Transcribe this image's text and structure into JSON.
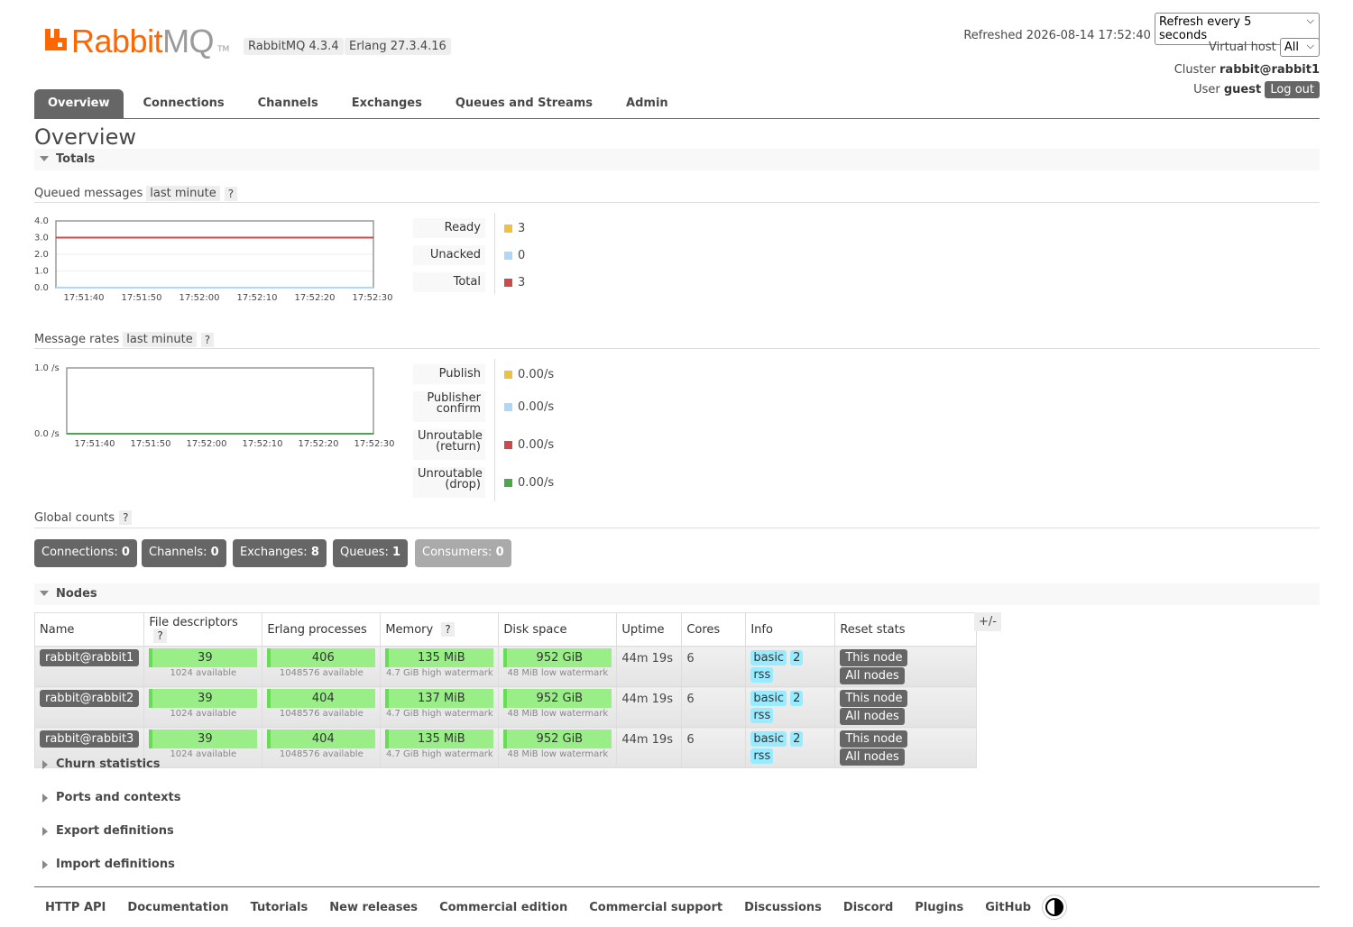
{
  "header": {
    "logo_rabbit": "Rabbit",
    "logo_mq": "MQ",
    "logo_tm": "TM",
    "rabbitmq_version": "RabbitMQ 4.3.4",
    "erlang_version": "Erlang 27.3.4.16",
    "refreshed": "Refreshed 2026-08-14 17:52:40",
    "refresh_select": "Refresh every 5 seconds",
    "vhost_label": "Virtual host",
    "vhost_value": "All",
    "cluster_label": "Cluster",
    "cluster_value": "rabbit@rabbit1",
    "user_label": "User",
    "user_value": "guest",
    "logout": "Log out"
  },
  "tabs": [
    "Overview",
    "Connections",
    "Channels",
    "Exchanges",
    "Queues and Streams",
    "Admin"
  ],
  "page_title": "Overview",
  "totals": {
    "section": "Totals",
    "queued_label": "Queued messages",
    "queued_range": "last minute",
    "rates_label": "Message rates",
    "rates_range": "last minute",
    "help": "?",
    "queued_legend": [
      {
        "label": "Ready",
        "value": "3",
        "color": "#edc240"
      },
      {
        "label": "Unacked",
        "value": "0",
        "color": "#afd8f8"
      },
      {
        "label": "Total",
        "value": "3",
        "color": "#cb4b4b"
      }
    ],
    "rates_legend": [
      {
        "label1": "Publish",
        "label2": "",
        "value": "0.00/s",
        "color": "#edc240"
      },
      {
        "label1": "Publisher",
        "label2": "confirm",
        "value": "0.00/s",
        "color": "#afd8f8"
      },
      {
        "label1": "Unroutable",
        "label2": "(return)",
        "value": "0.00/s",
        "color": "#cb4b4b"
      },
      {
        "label1": "Unroutable",
        "label2": "(drop)",
        "value": "0.00/s",
        "color": "#4da74d"
      }
    ],
    "global_label": "Global counts",
    "global_counts": [
      {
        "label": "Connections:",
        "value": "0"
      },
      {
        "label": "Channels:",
        "value": "0"
      },
      {
        "label": "Exchanges:",
        "value": "8"
      },
      {
        "label": "Queues:",
        "value": "1"
      },
      {
        "label": "Consumers:",
        "value": "0"
      }
    ]
  },
  "chart_data": [
    {
      "type": "line",
      "x": [
        "17:51:40",
        "17:51:50",
        "17:52:00",
        "17:52:10",
        "17:52:20",
        "17:52:30"
      ],
      "yticks": [
        "4.0",
        "3.0",
        "2.0",
        "1.0",
        "0.0"
      ],
      "ylim": [
        0,
        4
      ],
      "series": [
        {
          "name": "Ready",
          "values": [
            3,
            3,
            3,
            3,
            3,
            3
          ],
          "color": "#edc240"
        },
        {
          "name": "Unacked",
          "values": [
            0,
            0,
            0,
            0,
            0,
            0
          ],
          "color": "#afd8f8"
        },
        {
          "name": "Total",
          "values": [
            3,
            3,
            3,
            3,
            3,
            3
          ],
          "color": "#cb4b4b"
        }
      ]
    },
    {
      "type": "line",
      "x": [
        "17:51:40",
        "17:51:50",
        "17:52:00",
        "17:52:10",
        "17:52:20",
        "17:52:30"
      ],
      "yticks": [
        "1.0 /s",
        "0.0 /s"
      ],
      "ylim": [
        0,
        1
      ],
      "series": [
        {
          "name": "Publish",
          "values": [
            0,
            0,
            0,
            0,
            0,
            0
          ],
          "color": "#edc240"
        },
        {
          "name": "Publisher confirm",
          "values": [
            0,
            0,
            0,
            0,
            0,
            0
          ],
          "color": "#afd8f8"
        },
        {
          "name": "Unroutable (return)",
          "values": [
            0,
            0,
            0,
            0,
            0,
            0
          ],
          "color": "#cb4b4b"
        },
        {
          "name": "Unroutable (drop)",
          "values": [
            0,
            0,
            0,
            0,
            0,
            0
          ],
          "color": "#4da74d"
        }
      ]
    }
  ],
  "nodes": {
    "section": "Nodes",
    "columns": [
      "Name",
      "File descriptors",
      "Erlang processes",
      "Memory",
      "Disk space",
      "Uptime",
      "Cores",
      "Info",
      "Reset stats"
    ],
    "plusminus": "+/-",
    "rows": [
      {
        "name": "rabbit@rabbit1",
        "fd": "39",
        "fd_sub": "1024 available",
        "proc": "406",
        "proc_sub": "1048576 available",
        "mem": "135 MiB",
        "mem_sub": "4.7 GiB high watermark",
        "disk": "952 GiB",
        "disk_sub": "48 MiB low watermark",
        "uptime": "44m 19s",
        "cores": "6",
        "info": [
          "basic",
          "2",
          "rss"
        ],
        "reset_this": "This node",
        "reset_all": "All nodes"
      },
      {
        "name": "rabbit@rabbit2",
        "fd": "39",
        "fd_sub": "1024 available",
        "proc": "404",
        "proc_sub": "1048576 available",
        "mem": "137 MiB",
        "mem_sub": "4.7 GiB high watermark",
        "disk": "952 GiB",
        "disk_sub": "48 MiB low watermark",
        "uptime": "44m 19s",
        "cores": "6",
        "info": [
          "basic",
          "2",
          "rss"
        ],
        "reset_this": "This node",
        "reset_all": "All nodes"
      },
      {
        "name": "rabbit@rabbit3",
        "fd": "39",
        "fd_sub": "1024 available",
        "proc": "404",
        "proc_sub": "1048576 available",
        "mem": "135 MiB",
        "mem_sub": "4.7 GiB high watermark",
        "disk": "952 GiB",
        "disk_sub": "48 MiB low watermark",
        "uptime": "44m 19s",
        "cores": "6",
        "info": [
          "basic",
          "2",
          "rss"
        ],
        "reset_this": "This node",
        "reset_all": "All nodes"
      }
    ]
  },
  "collapsed_sections": [
    "Churn statistics",
    "Ports and contexts",
    "Export definitions",
    "Import definitions"
  ],
  "footer": [
    "HTTP API",
    "Documentation",
    "Tutorials",
    "New releases",
    "Commercial edition",
    "Commercial support",
    "Discussions",
    "Discord",
    "Plugins",
    "GitHub"
  ]
}
